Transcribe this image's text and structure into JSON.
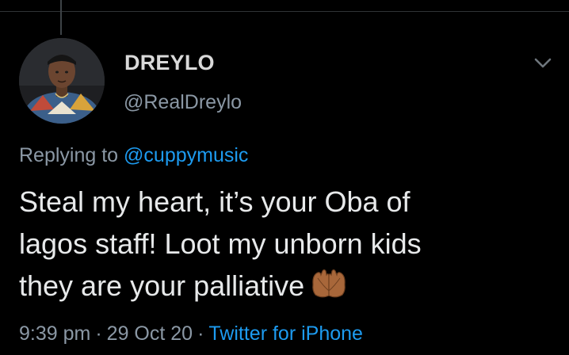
{
  "author": {
    "display_name": "DREYLO",
    "handle": "@RealDreylo"
  },
  "reply": {
    "prefix": "Replying to",
    "mention": "@cuppymusic"
  },
  "tweet": {
    "lines": [
      "Steal my heart, it’s your Oba of",
      "lagos staff! Loot my unborn kids",
      "they are your palliative"
    ],
    "emoji": "palms-up-together-emoji"
  },
  "meta": {
    "time": "9:39 pm",
    "separator": "·",
    "date": "29 Oct 20",
    "source": "Twitter for iPhone"
  },
  "icons": {
    "menu": "chevron-down-icon"
  },
  "colors": {
    "background": "#000000",
    "primary_text": "#e7e9ea",
    "secondary_text": "#8b98a5",
    "link": "#1d9bf0",
    "divider": "#2f3336"
  }
}
